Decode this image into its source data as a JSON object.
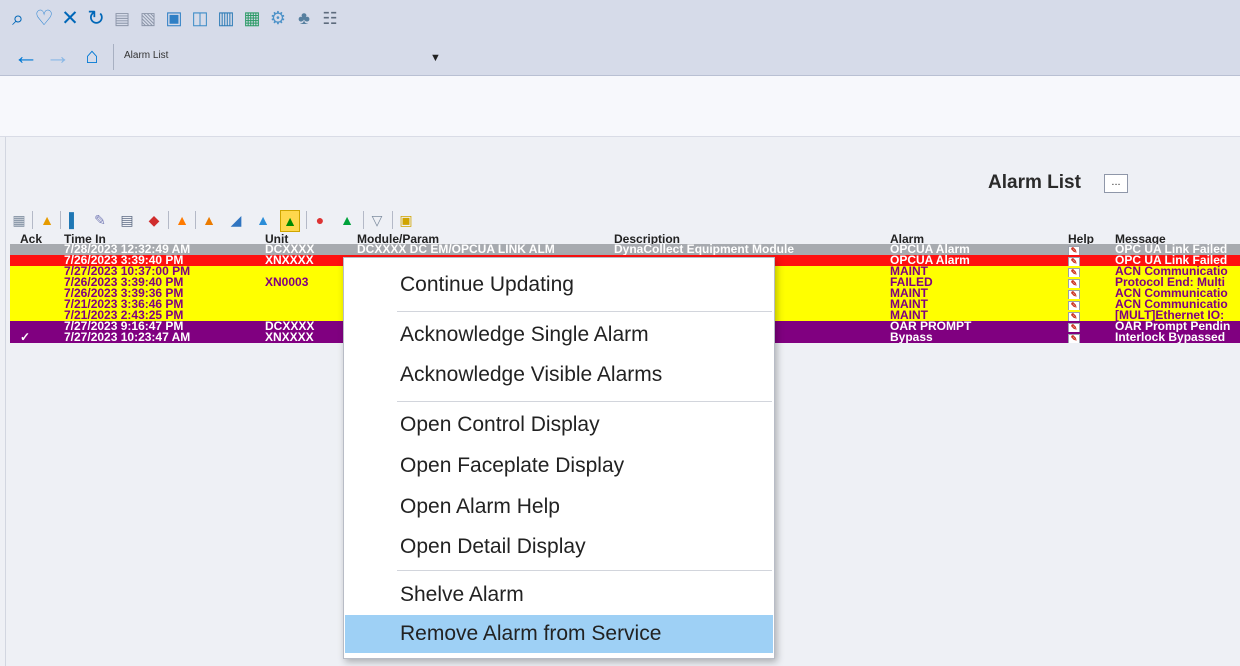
{
  "toolbar": {
    "icons": [
      "search-icon",
      "heartbeat-icon",
      "tools-icon",
      "refresh-icon",
      "document-icon",
      "chart-icon",
      "monitor-icon",
      "network-icon",
      "hierarchy-icon",
      "list-icon",
      "settings-icon",
      "plant-icon",
      "alarm-list-icon"
    ]
  },
  "navigation": {
    "title": "Alarm List",
    "dropdown_arrow": "▼"
  },
  "page": {
    "title": "Alarm List",
    "title_button": "..."
  },
  "alarm_tools": {
    "icons": [
      "grid-icon",
      "bell-icon",
      "bars-icon",
      "edit-icon",
      "document-icon",
      "alarm-pair-icon",
      "alarm-single-icon",
      "alarm-red-icon",
      "alarm-blue-icon",
      "alarm-yellow-icon",
      "alarm-active-icon",
      "alarm-multicolor-icon",
      "alarm-green-icon",
      "filter-icon",
      "config-icon"
    ]
  },
  "table": {
    "headers": [
      "Ack",
      "Time In",
      "Unit",
      "Module/Param",
      "Description",
      "Alarm",
      "Help",
      "Message"
    ],
    "rows": [
      {
        "ack": "",
        "time": "7/28/2023 12:32:49 AM",
        "unit": "DCXXXX",
        "module": "DCXXXX DC EM/OPCUA LINK ALM",
        "description": "DynaCollect Equipment Module",
        "alarm": "OPCUA Alarm",
        "message": "OPC UA Link Failed",
        "style": "gray"
      },
      {
        "ack": "",
        "time": "7/26/2023 3:39:40 PM",
        "unit": "XNXXXX",
        "module": "",
        "description": "e",
        "alarm": "OPCUA Alarm",
        "message": "OPC UA Link Failed",
        "style": "red"
      },
      {
        "ack": "",
        "time": "7/27/2023 10:37:00 PM",
        "unit": "",
        "module": "",
        "description": "",
        "alarm": "MAINT",
        "message": "ACN Communicatio",
        "style": "yellow"
      },
      {
        "ack": "",
        "time": "7/26/2023 3:39:40 PM",
        "unit": "XN0003",
        "module": "",
        "description": "e",
        "alarm": "FAILED",
        "message": "Protocol End: Multi",
        "style": "yellow"
      },
      {
        "ack": "",
        "time": "7/26/2023 3:39:36 PM",
        "unit": "",
        "module": "",
        "description": "",
        "alarm": "MAINT",
        "message": "ACN Communicatio",
        "style": "yellow"
      },
      {
        "ack": "",
        "time": "7/21/2023 3:36:46 PM",
        "unit": "",
        "module": "",
        "description": "",
        "alarm": "MAINT",
        "message": "ACN Communicatio",
        "style": "yellow"
      },
      {
        "ack": "",
        "time": "7/21/2023 2:43:25 PM",
        "unit": "",
        "module": "",
        "description": "",
        "alarm": "MAINT",
        "message": "[MULT]Ethernet IO:",
        "style": "yellow"
      },
      {
        "ack": "",
        "time": "7/27/2023 9:16:47 PM",
        "unit": "DCXXXX",
        "module": "",
        "description": "rt Module",
        "alarm": "OAR PROMPT",
        "message": "OAR Prompt Pendin",
        "style": "purple"
      },
      {
        "ack": "✓",
        "time": "7/27/2023 10:23:47 AM",
        "unit": "XNXXXX",
        "module": "",
        "description": "e",
        "alarm": "Bypass",
        "message": "Interlock Bypassed",
        "style": "purple"
      }
    ]
  },
  "context_menu": {
    "items": [
      "Continue Updating",
      "Acknowledge Single Alarm",
      "Acknowledge Visible Alarms",
      "Open Control Display",
      "Open Faceplate Display",
      "Open Alarm Help",
      "Open Detail Display",
      "Shelve Alarm",
      "Remove Alarm from Service"
    ],
    "selected": "Remove Alarm from Service"
  },
  "colors": {
    "gray": "#a7aaaf",
    "red": "#ff1010",
    "yellow": "#ffff00",
    "purple": "#800080",
    "menu_selected": "#9ed0f5"
  }
}
